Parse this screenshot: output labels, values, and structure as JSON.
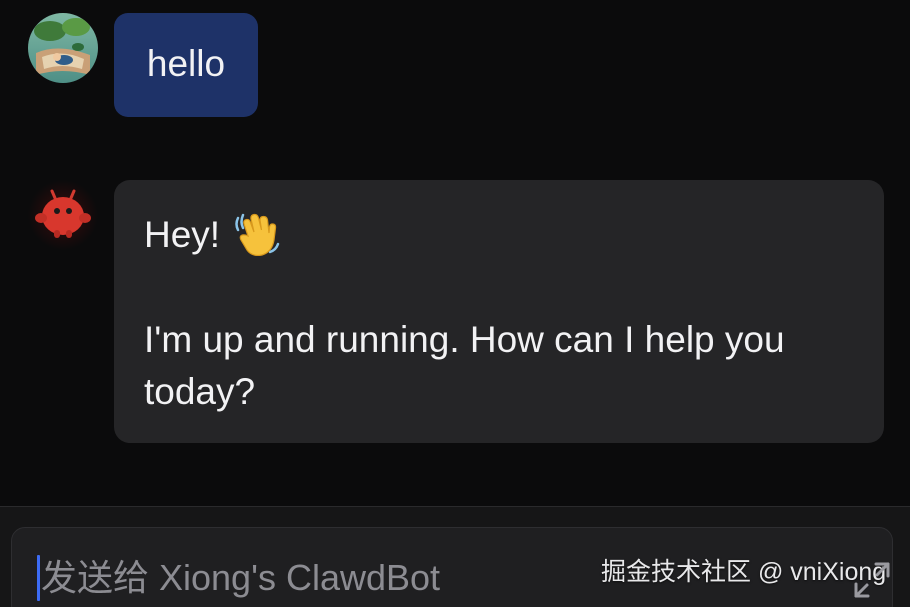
{
  "messages": [
    {
      "role": "user",
      "avatar_icon": "user-avatar-icon",
      "text": "hello",
      "bubble_color": "#1e3268"
    },
    {
      "role": "assistant",
      "avatar_icon": "bot-avatar-icon",
      "greeting": "Hey!",
      "greeting_emoji": "waving-hand-icon",
      "text": "I'm up and running. How can I help you today?",
      "bubble_color": "#252527"
    }
  ],
  "composer": {
    "placeholder": "发送给 Xiong's ClawdBot",
    "expand_icon": "expand-icon",
    "caret_color": "#3d6cf5"
  },
  "watermark": "掘金技术社区 @ vniXiong",
  "colors": {
    "background": "#0b0b0c",
    "text": "#f2f2f4",
    "placeholder": "#8c8c92"
  }
}
